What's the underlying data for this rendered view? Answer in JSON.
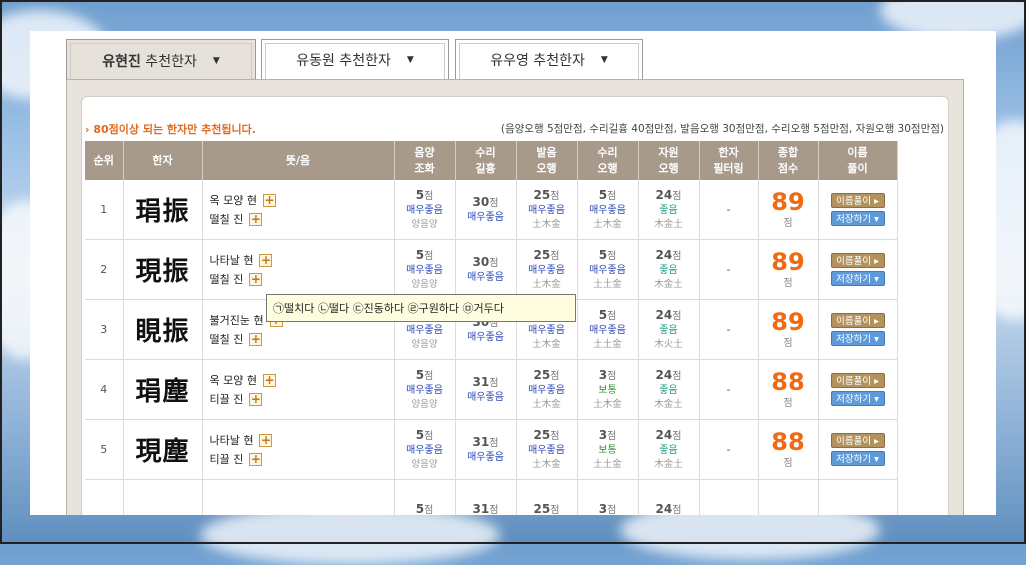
{
  "tabs": [
    {
      "name_bold": "유현진",
      "name_rest": " 추천한자",
      "active": true
    },
    {
      "name_bold": "유동원",
      "name_rest": " 추천한자",
      "active": false
    },
    {
      "name_bold": "유우영",
      "name_rest": " 추천한자",
      "active": false
    }
  ],
  "caret": "▼",
  "notice": "› 80점이상 되는 한자만 추천됩니다.",
  "legend": "(음양오행 5점만점, 수리길흉 40점만점, 발음오행 30점만점, 수리오행 5점만점, 자원오행 30점만점)",
  "headers": [
    {
      "l1": "순위",
      "l2": ""
    },
    {
      "l1": "한자",
      "l2": ""
    },
    {
      "l1": "뜻/음",
      "l2": ""
    },
    {
      "l1": "음양",
      "l2": "조화"
    },
    {
      "l1": "수리",
      "l2": "길흉"
    },
    {
      "l1": "발음",
      "l2": "오행"
    },
    {
      "l1": "수리",
      "l2": "오행"
    },
    {
      "l1": "자원",
      "l2": "오행"
    },
    {
      "l1": "한자",
      "l2": "필터링"
    },
    {
      "l1": "종합",
      "l2": "점수"
    },
    {
      "l1": "이름",
      "l2": "풀이"
    }
  ],
  "unit_jeom": "점",
  "plus_label": "+",
  "btn_interpret": "이름풀이 ▸",
  "btn_save": "저장하기 ▾",
  "rows": [
    {
      "rank": "1",
      "hanja": "琄振",
      "m1": "옥 모양 현",
      "m2": "떨칠 진",
      "c1": {
        "n": "5",
        "lvl": "매우좋음",
        "sub": "양음양"
      },
      "c2": {
        "n": "30",
        "lvl": "매우좋음",
        "sub": ""
      },
      "c3": {
        "n": "25",
        "lvl": "매우좋음",
        "sub": "土木金"
      },
      "c4": {
        "n": "5",
        "lvl": "매우좋음",
        "sub": "土木金"
      },
      "c5": {
        "n": "24",
        "lvl": "좋음",
        "sub": "木金土"
      },
      "filter": "-",
      "total": "89"
    },
    {
      "rank": "2",
      "hanja": "現振",
      "m1": "나타날 현",
      "m2": "떨칠 진",
      "c1": {
        "n": "5",
        "lvl": "매우좋음",
        "sub": "양음양"
      },
      "c2": {
        "n": "30",
        "lvl": "매우좋음",
        "sub": ""
      },
      "c3": {
        "n": "25",
        "lvl": "매우좋음",
        "sub": "土木金"
      },
      "c4": {
        "n": "5",
        "lvl": "매우좋음",
        "sub": "土土金"
      },
      "c5": {
        "n": "24",
        "lvl": "좋음",
        "sub": "木金土"
      },
      "filter": "-",
      "total": "89"
    },
    {
      "rank": "3",
      "hanja": "睍振",
      "m1": "불거진눈 현",
      "m2": "떨칠 진",
      "c1": {
        "n": "5",
        "lvl": "매우좋음",
        "sub": "양음양"
      },
      "c2": {
        "n": "30",
        "lvl": "매우좋음",
        "sub": ""
      },
      "c3": {
        "n": "25",
        "lvl": "매우좋음",
        "sub": "土木金"
      },
      "c4": {
        "n": "5",
        "lvl": "매우좋음",
        "sub": "土土金"
      },
      "c5": {
        "n": "24",
        "lvl": "좋음",
        "sub": "木火土"
      },
      "filter": "-",
      "total": "89"
    },
    {
      "rank": "4",
      "hanja": "琄塵",
      "m1": "옥 모양 현",
      "m2": "티끌 진",
      "c1": {
        "n": "5",
        "lvl": "매우좋음",
        "sub": "양음양"
      },
      "c2": {
        "n": "31",
        "lvl": "매우좋음",
        "sub": ""
      },
      "c3": {
        "n": "25",
        "lvl": "매우좋음",
        "sub": "土木金"
      },
      "c4": {
        "n": "3",
        "lvl": "보통",
        "sub": "土木金"
      },
      "c5": {
        "n": "24",
        "lvl": "좋음",
        "sub": "木金土"
      },
      "filter": "-",
      "total": "88"
    },
    {
      "rank": "5",
      "hanja": "現塵",
      "m1": "나타날 현",
      "m2": "티끌 진",
      "c1": {
        "n": "5",
        "lvl": "매우좋음",
        "sub": "양음양"
      },
      "c2": {
        "n": "31",
        "lvl": "매우좋음",
        "sub": ""
      },
      "c3": {
        "n": "25",
        "lvl": "매우좋음",
        "sub": "土木金"
      },
      "c4": {
        "n": "3",
        "lvl": "보통",
        "sub": "土土金"
      },
      "c5": {
        "n": "24",
        "lvl": "좋음",
        "sub": "木金土"
      },
      "filter": "-",
      "total": "88"
    },
    {
      "rank": "",
      "hanja": "",
      "m1": "",
      "m2": "",
      "c1": {
        "n": "5",
        "lvl": "",
        "sub": ""
      },
      "c2": {
        "n": "31",
        "lvl": "",
        "sub": ""
      },
      "c3": {
        "n": "25",
        "lvl": "",
        "sub": ""
      },
      "c4": {
        "n": "3",
        "lvl": "",
        "sub": ""
      },
      "c5": {
        "n": "24",
        "lvl": "",
        "sub": ""
      },
      "filter": "",
      "total": ""
    }
  ],
  "tooltip": "㉠떨치다 ㉡떨다 ㉢진동하다 ㉣구원하다 ㉤거두다"
}
